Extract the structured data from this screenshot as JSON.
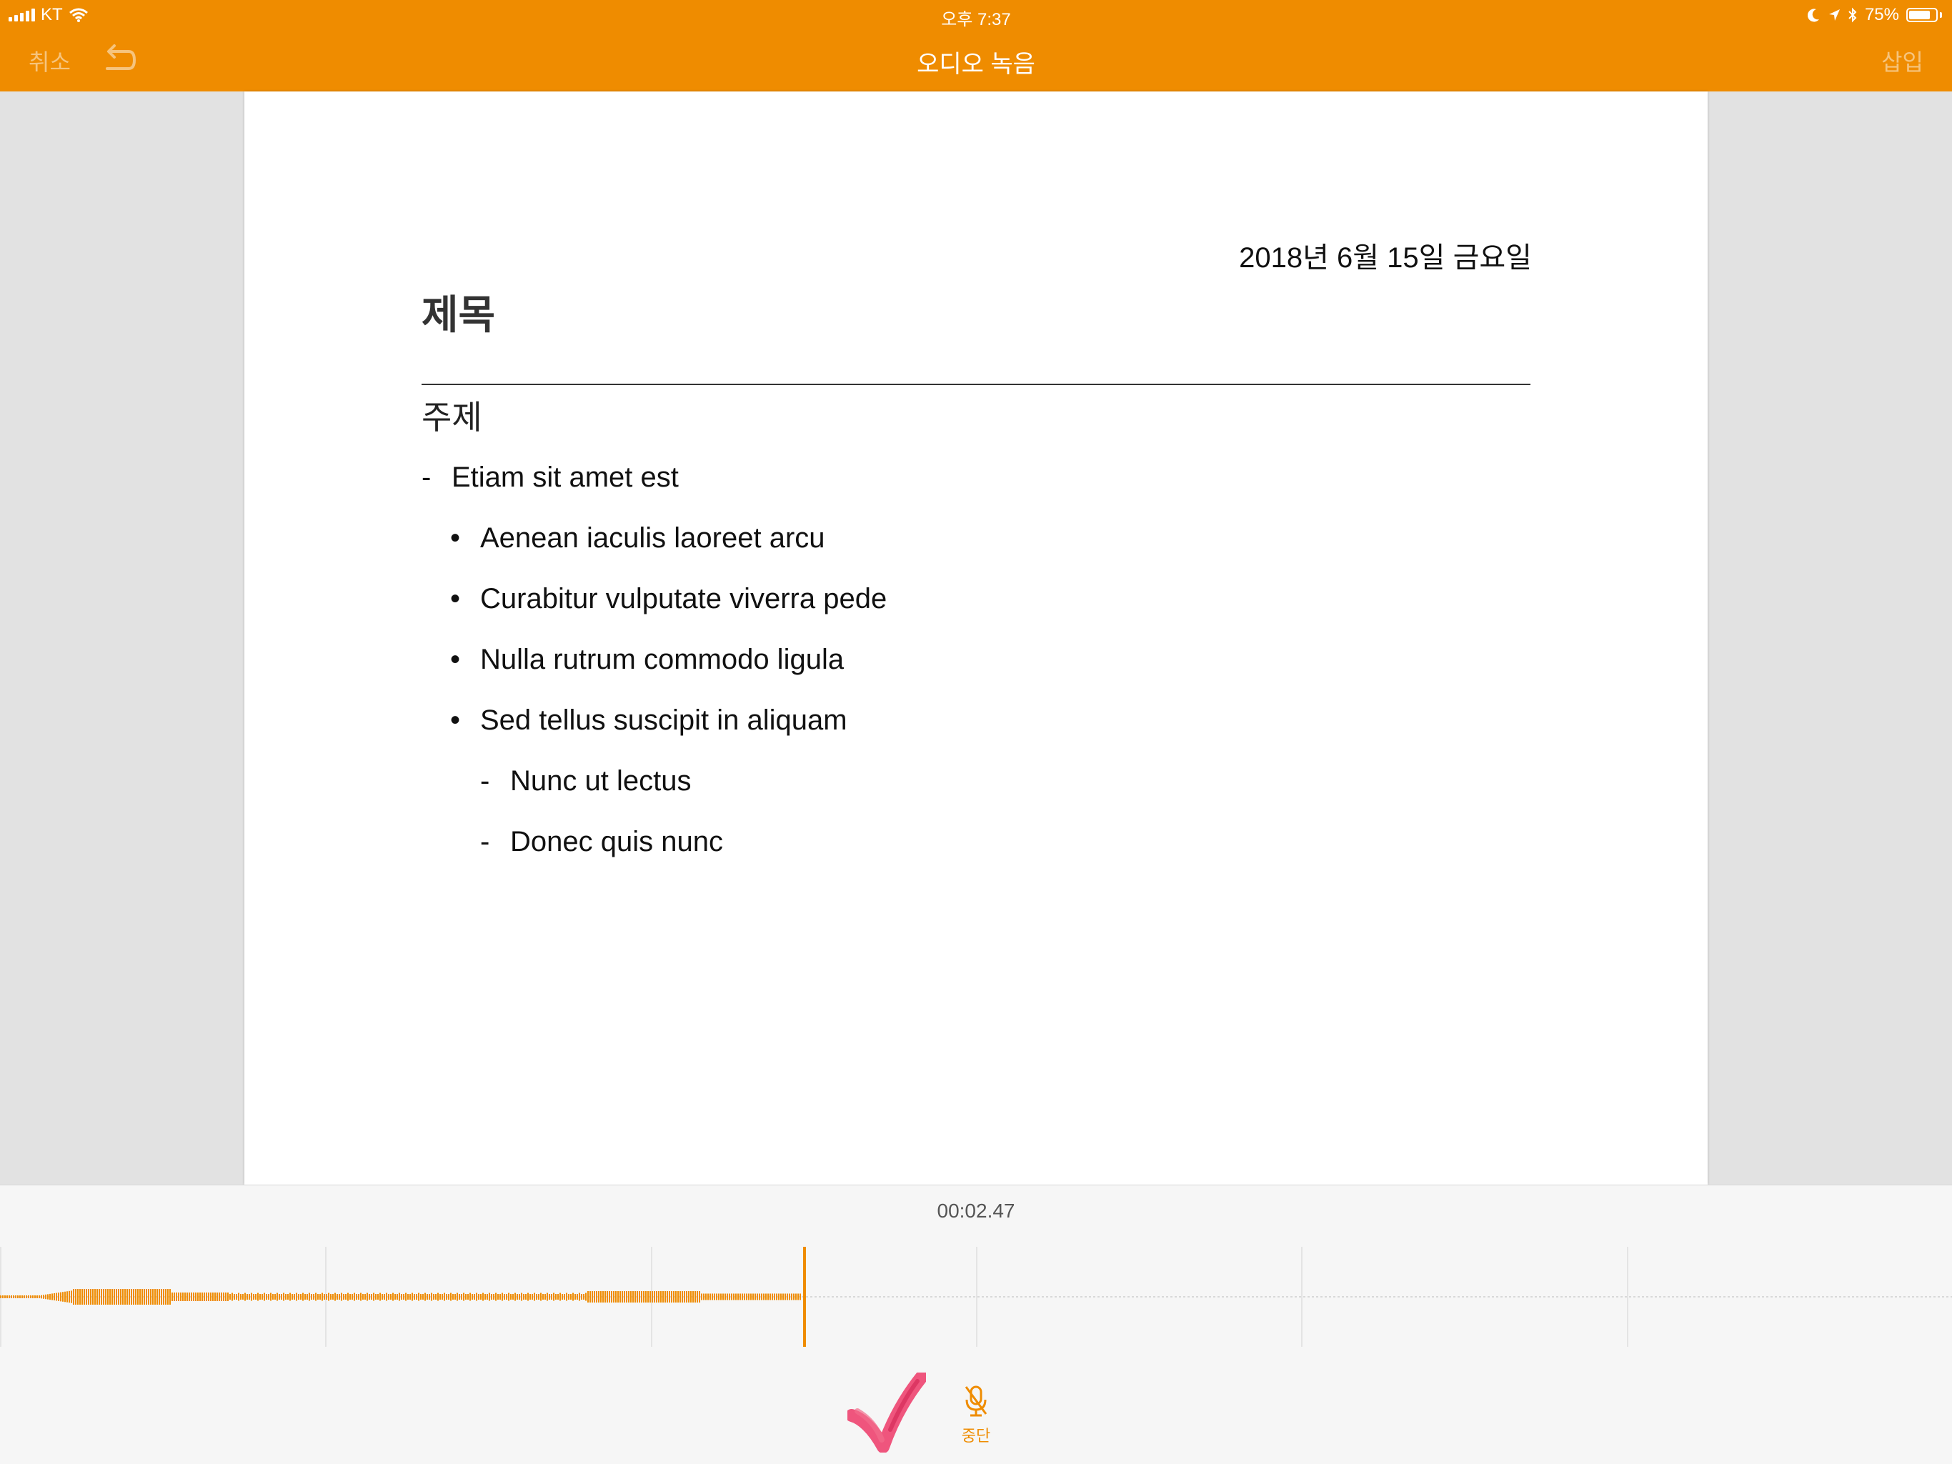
{
  "status_bar": {
    "carrier": "KT",
    "time": "오후 7:37",
    "battery": "75%",
    "battery_level": 0.75
  },
  "nav": {
    "cancel": "취소",
    "title": "오디오 녹음",
    "insert": "삽입"
  },
  "document": {
    "date": "2018년 6월 15일 금요일",
    "title": "제목",
    "subject": "주제",
    "items": [
      {
        "marker": "-",
        "text": "Etiam sit amet est"
      },
      {
        "marker": "•",
        "text": "Aenean iaculis laoreet arcu"
      },
      {
        "marker": "•",
        "text": "Curabitur vulputate viverra pede"
      },
      {
        "marker": "•",
        "text": "Nulla rutrum commodo ligula"
      },
      {
        "marker": "•",
        "text": "Sed tellus suscipit in aliquam"
      },
      {
        "marker": "-",
        "text": "Nunc ut lectus"
      },
      {
        "marker": "-",
        "text": "Donec quis nunc"
      }
    ]
  },
  "recording": {
    "elapsed": "00:02.47",
    "stop_label": "중단"
  },
  "colors": {
    "accent": "#ef8c00",
    "accent_dim": "#f6c47d"
  },
  "icons": [
    "signal-icon",
    "wifi-icon",
    "moon-icon",
    "location-icon",
    "bluetooth-icon",
    "battery-icon",
    "undo-icon",
    "mic-off-icon",
    "checkmark-annotation"
  ]
}
